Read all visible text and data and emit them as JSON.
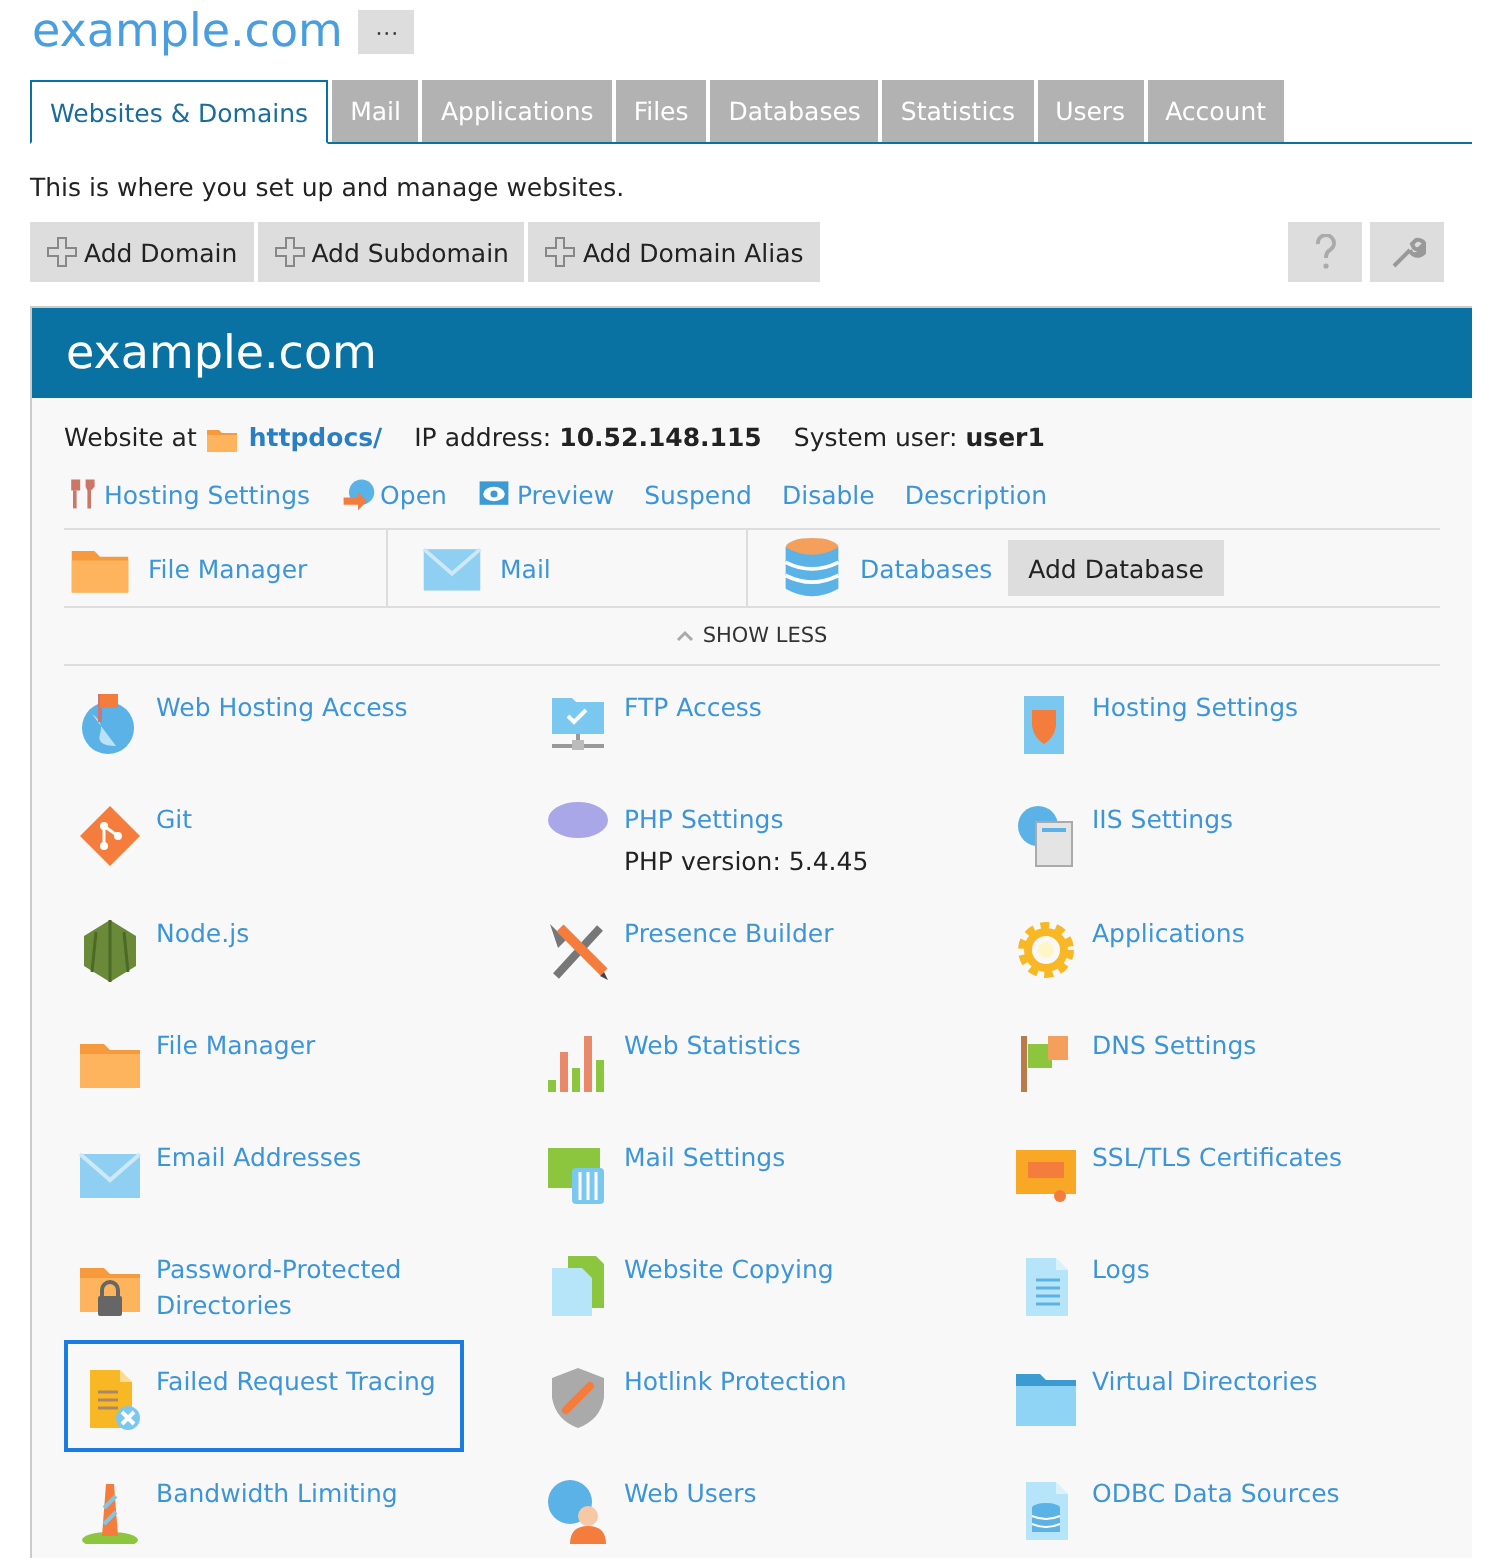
{
  "title": "example.com",
  "more_button": "···",
  "tabs": [
    {
      "label": "Websites & Domains",
      "selected": true
    },
    {
      "label": "Mail",
      "selected": false
    },
    {
      "label": "Applications",
      "selected": false
    },
    {
      "label": "Files",
      "selected": false
    },
    {
      "label": "Databases",
      "selected": false
    },
    {
      "label": "Statistics",
      "selected": false
    },
    {
      "label": "Users",
      "selected": false
    },
    {
      "label": "Account",
      "selected": false
    }
  ],
  "intro": "This is where you set up and manage websites.",
  "toolbar": [
    "Add Domain",
    "Add Subdomain",
    "Add Domain Alias"
  ],
  "domain": {
    "name": "example.com",
    "info": [
      {
        "label": "Website at",
        "value": "httpdocs/",
        "kind": "link"
      },
      {
        "label": "IP address:",
        "value": "10.52.148.115",
        "kind": "text"
      },
      {
        "label": "System user:",
        "value": "user1",
        "kind": "text"
      }
    ],
    "actions": [
      "Hosting Settings",
      "Open",
      "Preview",
      "Suspend",
      "Disable",
      "Description"
    ],
    "quick": [
      {
        "label": "File Manager"
      },
      {
        "label": "Mail"
      },
      {
        "label": "Databases",
        "button": "Add Database"
      }
    ],
    "toggle": "SHOW LESS",
    "tools": [
      {
        "label": "Web Hosting Access",
        "selected": false
      },
      {
        "label": "FTP Access",
        "selected": false
      },
      {
        "label": "Hosting Settings",
        "selected": false
      },
      {
        "label": "Git",
        "selected": false
      },
      {
        "label": "PHP Settings",
        "note": "PHP version: 5.4.45",
        "selected": false
      },
      {
        "label": "IIS Settings",
        "selected": false
      },
      {
        "label": "Node.js",
        "selected": false
      },
      {
        "label": "Presence Builder",
        "selected": false
      },
      {
        "label": "Applications",
        "selected": false
      },
      {
        "label": "File Manager",
        "selected": false
      },
      {
        "label": "Web Statistics",
        "selected": false
      },
      {
        "label": "DNS Settings",
        "selected": false
      },
      {
        "label": "Email Addresses",
        "selected": false
      },
      {
        "label": "Mail Settings",
        "selected": false
      },
      {
        "label": "SSL/TLS Certificates",
        "selected": false
      },
      {
        "label": "Password-Protected Directories",
        "selected": false
      },
      {
        "label": "Website Copying",
        "selected": false
      },
      {
        "label": "Logs",
        "selected": false
      },
      {
        "label": "Failed Request Tracing",
        "selected": true
      },
      {
        "label": "Hotlink Protection",
        "selected": false
      },
      {
        "label": "Virtual Directories",
        "selected": false
      },
      {
        "label": "Bandwidth Limiting",
        "selected": false
      },
      {
        "label": "Web Users",
        "selected": false
      },
      {
        "label": "ODBC Data Sources",
        "selected": false
      }
    ]
  }
}
